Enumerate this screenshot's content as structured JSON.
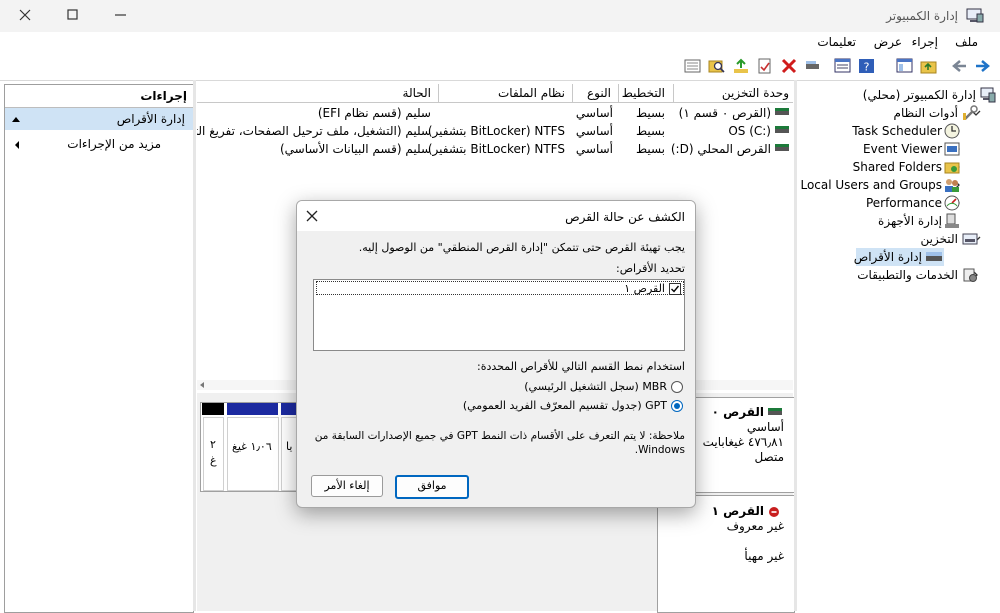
{
  "window": {
    "title": "إدارة الكمبيوتر"
  },
  "menu": {
    "file": "ملف",
    "action": "إجراء",
    "view": "عرض",
    "help": "تعليمات"
  },
  "actions_pane": {
    "header": "إجراءات",
    "selected": "إدارة الأقراص",
    "more": "مزيد من الإجراءات"
  },
  "volume_table": {
    "columns": [
      "وحدة التخزين",
      "التخطيط",
      "النوع",
      "نظام الملفات",
      "الحالة"
    ],
    "rows": [
      {
        "volume": "(القرص ٠ قسم ١)",
        "layout": "بسيط",
        "type": "أساسي",
        "fs": "",
        "status": "سليم (قسم نظام EFI)"
      },
      {
        "volume": "OS (C:)",
        "layout": "بسيط",
        "type": "أساسي",
        "fs": "NTFS (BitLocker بتشفير)",
        "status": "سليم (التشغيل، ملف ترحيل الصفحات، تفريغ التعطل"
      },
      {
        "volume": "القرص المحلي (D:)",
        "layout": "بسيط",
        "type": "أساسي",
        "fs": "NTFS (BitLocker بتشفير)",
        "status": "سليم (قسم البيانات الأساسي)"
      }
    ]
  },
  "disk_graphics": {
    "disk0": {
      "name": "القرص ٠",
      "type": "أساسي",
      "size": "٤٧٦٫٨١ غيغابايت",
      "state": "متصل"
    },
    "disk1": {
      "name": "القرص ١",
      "type": "غير معروف",
      "state": "غير مهيأ"
    },
    "part_size_a": "١٫٠٦ غيغ",
    "part_size_b": "يا",
    "part_size_c1": "٢",
    "part_size_c2": "غ"
  },
  "tree": {
    "root": "إدارة الكمبيوتر (محلي)",
    "system_tools": "أدوات النظام",
    "task_scheduler": "Task Scheduler",
    "event_viewer": "Event Viewer",
    "shared_folders": "Shared Folders",
    "local_users": "Local Users and Groups",
    "performance": "Performance",
    "device_manager": "إدارة الأجهزة",
    "storage": "التخزين",
    "disk_management": "إدارة الأقراص",
    "services": "الخدمات والتطبيقات"
  },
  "dialog": {
    "title": "الكشف عن حالة القرص",
    "message": "يجب تهيئة القرص حتى تتمكن \"إدارة القرص المنطقي\" من الوصول إليه.",
    "select_label": "تحديد الأقراص:",
    "disk_item": "القرص ١",
    "partition_style_label": "استخدام نمط القسم التالي للأقراص المحددة:",
    "mbr_option": "MBR (سجل التشغيل الرئيسي)",
    "gpt_option": "GPT (جدول تقسيم المعرّف الفريد العمومي)",
    "note_line1": "ملاحظة: لا يتم التعرف على الأقسام ذات النمط GPT في جميع الإصدارات السابقة من",
    "note_line2": "Windows.",
    "ok": "موافق",
    "cancel": "إلغاء الأمر"
  },
  "colors": {
    "selection": "#cfe3f5",
    "accent": "#0067c0",
    "partition_blue": "#1c2aa0",
    "partition_black": "#000000"
  }
}
